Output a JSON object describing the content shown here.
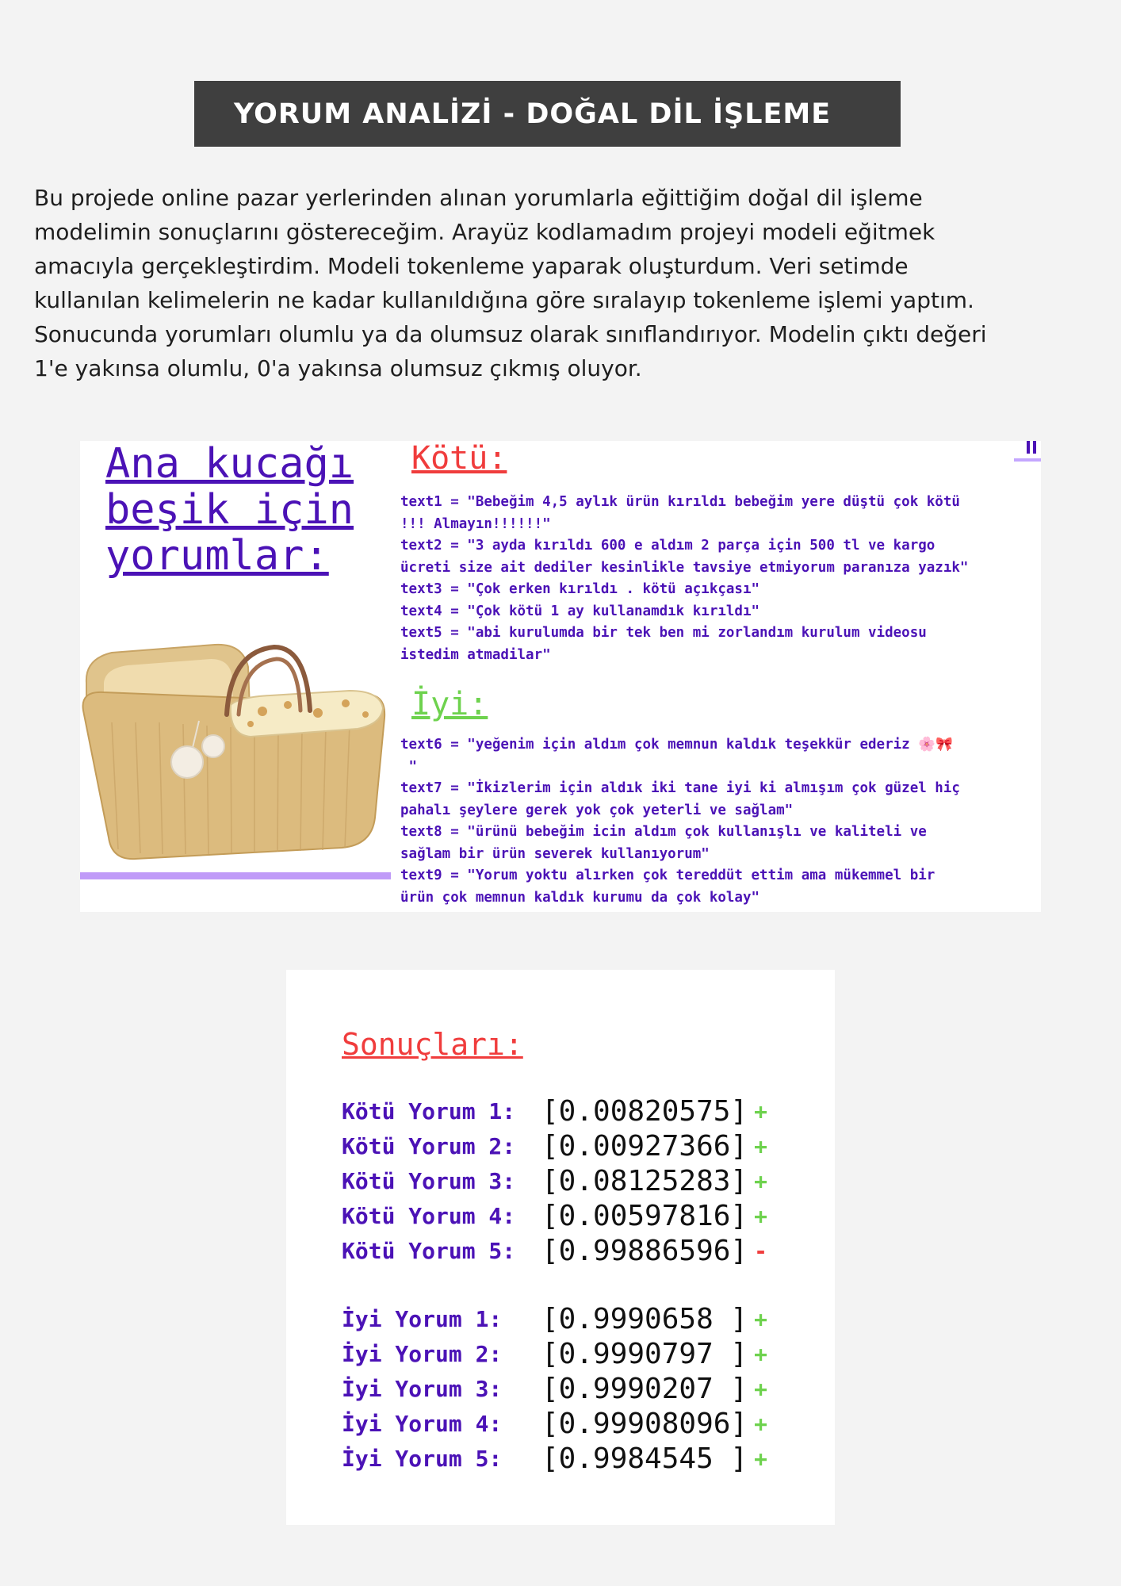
{
  "title": "YORUM ANALİZİ - DOĞAL DİL İŞLEME",
  "intro": {
    "lines": [
      "Bu projede online pazar yerlerinden alınan yorumlarla eğittiğim doğal dil işleme",
      "modelimin sonuçlarını göstereceğim. Arayüz kodlamadım projeyi modeli eğitmek",
      "amacıyla gerçekleştirdim. Modeli tokenleme yaparak oluşturdum. Veri setimde",
      "kullanılan kelimelerin ne kadar kullanıldığına göre sıralayıp tokenleme işlemi yaptım.",
      "Sonucunda yorumları olumlu ya da olumsuz olarak sınıflandırıyor. Modelin çıktı değeri",
      "1'e yakınsa olumlu, 0'a yakınsa olumsuz çıkmış oluyor."
    ]
  },
  "comments": {
    "heading": "Ana kucağı beşik için yorumlar:",
    "bad_heading": "Kötü:",
    "good_heading": "İyi:",
    "bad_lines": [
      "text1 = \"Bebeğim 4,5 aylık ürün kırıldı bebeğim yere düştü çok kötü",
      "!!! Almayın!!!!!!\"",
      "text2 = \"3 ayda kırıldı 600 e aldım 2 parça için 500 tl ve kargo",
      "ücreti size ait dediler kesinlikle tavsiye etmiyorum paranıza yazık\"",
      "text3 = \"Çok erken kırıldı . kötü açıkçası\"",
      "text4 = \"Çok kötü 1 ay kullanamdık kırıldı\"",
      "text5 = \"abi kurulumda bir tek ben mi zorlandım kurulum videosu",
      "istedim atmadilar\""
    ],
    "good_lines": [
      "text6 = \"yeğenim için aldım çok memnun kaldık teşekkür ederiz 🌸🎀",
      " \"",
      "text7 = \"İkizlerim için aldık iki tane iyi ki almışım çok güzel hiç",
      "pahalı şeylere gerek yok çok yeterli ve sağlam\"",
      "text8 = \"ürünü bebeğim icin aldım çok kullanışlı ve kaliteli ve",
      "sağlam bir ürün severek kullanıyorum\"",
      "text9 = \"Yorum yoktu alırken çok tereddüt ettim ama mükemmel bir",
      "ürün çok memnun kaldık kurumu da çok kolay\""
    ]
  },
  "results": {
    "heading": "Sonuçları:",
    "bad": [
      {
        "label": "Kötü Yorum 1:",
        "value": "[0.00820575]",
        "sign": "+"
      },
      {
        "label": "Kötü Yorum 2:",
        "value": "[0.00927366]",
        "sign": "+"
      },
      {
        "label": "Kötü Yorum 3:",
        "value": "[0.08125283]",
        "sign": "+"
      },
      {
        "label": "Kötü Yorum 4:",
        "value": "[0.00597816]",
        "sign": "+"
      },
      {
        "label": "Kötü Yorum 5:",
        "value": "[0.99886596]",
        "sign": "-"
      }
    ],
    "good": [
      {
        "label": "İyi Yorum 1:",
        "value": "[0.9990658 ]",
        "sign": "+"
      },
      {
        "label": "İyi Yorum 2:",
        "value": "[0.9990797 ]",
        "sign": "+"
      },
      {
        "label": "İyi Yorum 3:",
        "value": "[0.9990207 ]",
        "sign": "+"
      },
      {
        "label": "İyi Yorum 4:",
        "value": "[0.99908096]",
        "sign": "+"
      },
      {
        "label": "İyi Yorum 5:",
        "value": "[0.9984545 ]",
        "sign": "+"
      }
    ]
  },
  "colors": {
    "title_bg": "#3f3f3f",
    "code_purple": "#4b12b6",
    "bad_red": "#f03c3c",
    "good_green": "#6ed24e",
    "accent_line": "#c09bf8"
  },
  "icons": [
    "baby-basket-illustration"
  ]
}
